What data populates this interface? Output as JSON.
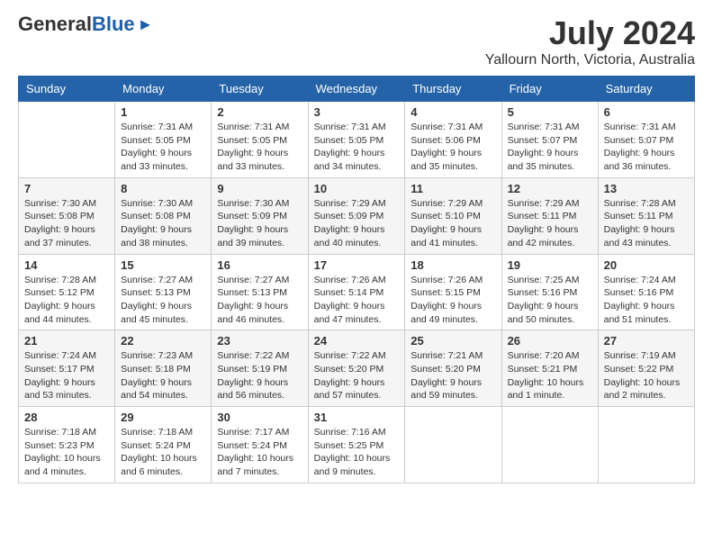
{
  "header": {
    "logo_general": "General",
    "logo_blue": "Blue",
    "month_year": "July 2024",
    "location": "Yallourn North, Victoria, Australia"
  },
  "days_of_week": [
    "Sunday",
    "Monday",
    "Tuesday",
    "Wednesday",
    "Thursday",
    "Friday",
    "Saturday"
  ],
  "weeks": [
    [
      {
        "day": "",
        "sunrise": "",
        "sunset": "",
        "daylight": ""
      },
      {
        "day": "1",
        "sunrise": "Sunrise: 7:31 AM",
        "sunset": "Sunset: 5:05 PM",
        "daylight": "Daylight: 9 hours and 33 minutes."
      },
      {
        "day": "2",
        "sunrise": "Sunrise: 7:31 AM",
        "sunset": "Sunset: 5:05 PM",
        "daylight": "Daylight: 9 hours and 33 minutes."
      },
      {
        "day": "3",
        "sunrise": "Sunrise: 7:31 AM",
        "sunset": "Sunset: 5:05 PM",
        "daylight": "Daylight: 9 hours and 34 minutes."
      },
      {
        "day": "4",
        "sunrise": "Sunrise: 7:31 AM",
        "sunset": "Sunset: 5:06 PM",
        "daylight": "Daylight: 9 hours and 35 minutes."
      },
      {
        "day": "5",
        "sunrise": "Sunrise: 7:31 AM",
        "sunset": "Sunset: 5:07 PM",
        "daylight": "Daylight: 9 hours and 35 minutes."
      },
      {
        "day": "6",
        "sunrise": "Sunrise: 7:31 AM",
        "sunset": "Sunset: 5:07 PM",
        "daylight": "Daylight: 9 hours and 36 minutes."
      }
    ],
    [
      {
        "day": "7",
        "sunrise": "Sunrise: 7:30 AM",
        "sunset": "Sunset: 5:08 PM",
        "daylight": "Daylight: 9 hours and 37 minutes."
      },
      {
        "day": "8",
        "sunrise": "Sunrise: 7:30 AM",
        "sunset": "Sunset: 5:08 PM",
        "daylight": "Daylight: 9 hours and 38 minutes."
      },
      {
        "day": "9",
        "sunrise": "Sunrise: 7:30 AM",
        "sunset": "Sunset: 5:09 PM",
        "daylight": "Daylight: 9 hours and 39 minutes."
      },
      {
        "day": "10",
        "sunrise": "Sunrise: 7:29 AM",
        "sunset": "Sunset: 5:09 PM",
        "daylight": "Daylight: 9 hours and 40 minutes."
      },
      {
        "day": "11",
        "sunrise": "Sunrise: 7:29 AM",
        "sunset": "Sunset: 5:10 PM",
        "daylight": "Daylight: 9 hours and 41 minutes."
      },
      {
        "day": "12",
        "sunrise": "Sunrise: 7:29 AM",
        "sunset": "Sunset: 5:11 PM",
        "daylight": "Daylight: 9 hours and 42 minutes."
      },
      {
        "day": "13",
        "sunrise": "Sunrise: 7:28 AM",
        "sunset": "Sunset: 5:11 PM",
        "daylight": "Daylight: 9 hours and 43 minutes."
      }
    ],
    [
      {
        "day": "14",
        "sunrise": "Sunrise: 7:28 AM",
        "sunset": "Sunset: 5:12 PM",
        "daylight": "Daylight: 9 hours and 44 minutes."
      },
      {
        "day": "15",
        "sunrise": "Sunrise: 7:27 AM",
        "sunset": "Sunset: 5:13 PM",
        "daylight": "Daylight: 9 hours and 45 minutes."
      },
      {
        "day": "16",
        "sunrise": "Sunrise: 7:27 AM",
        "sunset": "Sunset: 5:13 PM",
        "daylight": "Daylight: 9 hours and 46 minutes."
      },
      {
        "day": "17",
        "sunrise": "Sunrise: 7:26 AM",
        "sunset": "Sunset: 5:14 PM",
        "daylight": "Daylight: 9 hours and 47 minutes."
      },
      {
        "day": "18",
        "sunrise": "Sunrise: 7:26 AM",
        "sunset": "Sunset: 5:15 PM",
        "daylight": "Daylight: 9 hours and 49 minutes."
      },
      {
        "day": "19",
        "sunrise": "Sunrise: 7:25 AM",
        "sunset": "Sunset: 5:16 PM",
        "daylight": "Daylight: 9 hours and 50 minutes."
      },
      {
        "day": "20",
        "sunrise": "Sunrise: 7:24 AM",
        "sunset": "Sunset: 5:16 PM",
        "daylight": "Daylight: 9 hours and 51 minutes."
      }
    ],
    [
      {
        "day": "21",
        "sunrise": "Sunrise: 7:24 AM",
        "sunset": "Sunset: 5:17 PM",
        "daylight": "Daylight: 9 hours and 53 minutes."
      },
      {
        "day": "22",
        "sunrise": "Sunrise: 7:23 AM",
        "sunset": "Sunset: 5:18 PM",
        "daylight": "Daylight: 9 hours and 54 minutes."
      },
      {
        "day": "23",
        "sunrise": "Sunrise: 7:22 AM",
        "sunset": "Sunset: 5:19 PM",
        "daylight": "Daylight: 9 hours and 56 minutes."
      },
      {
        "day": "24",
        "sunrise": "Sunrise: 7:22 AM",
        "sunset": "Sunset: 5:20 PM",
        "daylight": "Daylight: 9 hours and 57 minutes."
      },
      {
        "day": "25",
        "sunrise": "Sunrise: 7:21 AM",
        "sunset": "Sunset: 5:20 PM",
        "daylight": "Daylight: 9 hours and 59 minutes."
      },
      {
        "day": "26",
        "sunrise": "Sunrise: 7:20 AM",
        "sunset": "Sunset: 5:21 PM",
        "daylight": "Daylight: 10 hours and 1 minute."
      },
      {
        "day": "27",
        "sunrise": "Sunrise: 7:19 AM",
        "sunset": "Sunset: 5:22 PM",
        "daylight": "Daylight: 10 hours and 2 minutes."
      }
    ],
    [
      {
        "day": "28",
        "sunrise": "Sunrise: 7:18 AM",
        "sunset": "Sunset: 5:23 PM",
        "daylight": "Daylight: 10 hours and 4 minutes."
      },
      {
        "day": "29",
        "sunrise": "Sunrise: 7:18 AM",
        "sunset": "Sunset: 5:24 PM",
        "daylight": "Daylight: 10 hours and 6 minutes."
      },
      {
        "day": "30",
        "sunrise": "Sunrise: 7:17 AM",
        "sunset": "Sunset: 5:24 PM",
        "daylight": "Daylight: 10 hours and 7 minutes."
      },
      {
        "day": "31",
        "sunrise": "Sunrise: 7:16 AM",
        "sunset": "Sunset: 5:25 PM",
        "daylight": "Daylight: 10 hours and 9 minutes."
      },
      {
        "day": "",
        "sunrise": "",
        "sunset": "",
        "daylight": ""
      },
      {
        "day": "",
        "sunrise": "",
        "sunset": "",
        "daylight": ""
      },
      {
        "day": "",
        "sunrise": "",
        "sunset": "",
        "daylight": ""
      }
    ]
  ]
}
